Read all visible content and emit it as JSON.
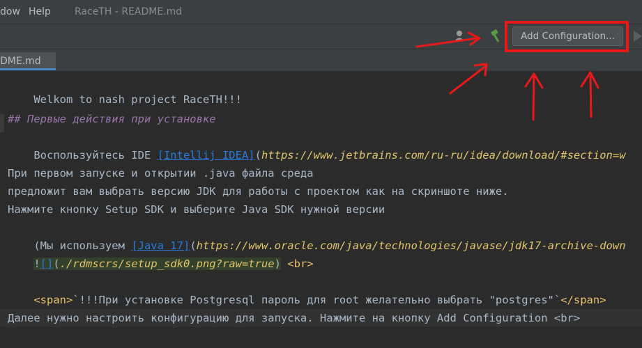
{
  "menubar": {
    "menu_window": "dow",
    "menu_help": "Help",
    "title": "RaceTH - README.md"
  },
  "toolbar": {
    "add_config_label": "Add Configuration..."
  },
  "tabs": [
    {
      "label": "DME.md"
    }
  ],
  "editor": {
    "line1": "Welkom to nash project RaceTH!!!",
    "line3": "## Первые действия при установке",
    "line4_prefix": "Воспользуйтесь IDE ",
    "line4_link": "[Intellij IDEA]",
    "line4_paren_open": "(",
    "line4_url": "https://www.jetbrains.com/ru-ru/idea/download/#section=w",
    "line6": "При первом запуске и открытии .java файла среда",
    "line7": "предложит вам выбрать версию JDK для работы с проектом как на скриншоте ниже.",
    "line8": "Нажмите кнопку Setup SDK и выберите Java SDK нужной версии",
    "line9_prefix": "(Мы используем ",
    "line9_link": "[Java 17]",
    "line9_paren_open": "(",
    "line9_url": "https://www.oracle.com/java/technologies/javase/jdk17-archive-down",
    "line10_bang": "!",
    "line10_link": "[]",
    "line10_paren_open": "(",
    "line10_url": "./rdmscrs/setup_sdk0.png?raw=true",
    "line10_paren_close": ")",
    "line10_tag": " <br>",
    "line12_tag_open": "<span>",
    "line12_code": "`!!!При установке Postgresql пароль для root желательно выбрать \"postgres\"`",
    "line12_tag_close": "</span>",
    "line14": "Далее нужно настроить конфигурацию для запуска. Нажмите на кнопку Add Configuration <br>"
  },
  "colors": {
    "annotation_red": "#e8191a",
    "accent_blue": "#4a88c7"
  }
}
